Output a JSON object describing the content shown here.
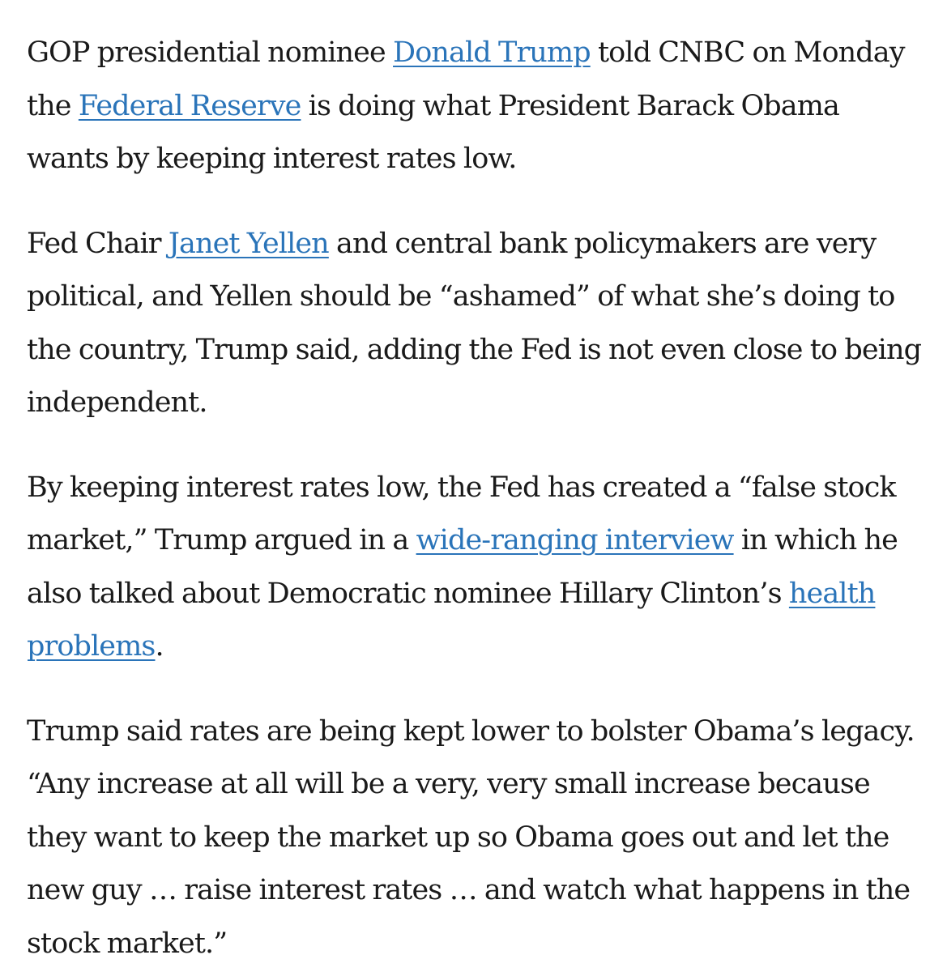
{
  "colors": {
    "text": "#1a1a1a",
    "link": "#2a74b9",
    "background": "#ffffff"
  },
  "article": {
    "p1": {
      "t1": "GOP presidential nominee ",
      "link1": "Donald Trump",
      "t2": " told CNBC on Monday the ",
      "link2": "Federal Reserve",
      "t3": " is doing what President Barack Obama wants by keeping interest rates low."
    },
    "p2": {
      "t1": "Fed Chair ",
      "link1": "Janet Yellen",
      "t2": " and central bank policymakers are very political, and Yellen should be “ashamed” of what she’s doing to the country, Trump said, adding the Fed is not even close to being independent."
    },
    "p3": {
      "t1": "By keeping interest rates low, the Fed has created a “false stock market,” Trump argued in a ",
      "link1": "wide-ranging interview",
      "t2": " in which he also talked about Democratic nominee Hillary Clinton’s ",
      "link2": "health problems",
      "t3": "."
    },
    "p4": {
      "t1": "Trump said rates are being kept lower to bolster Obama’s legacy. “Any increase at all will be a very, very small increase because they want to keep the market up so Obama goes out and let the new guy … raise interest rates … and watch what happens in the stock market.”"
    }
  }
}
